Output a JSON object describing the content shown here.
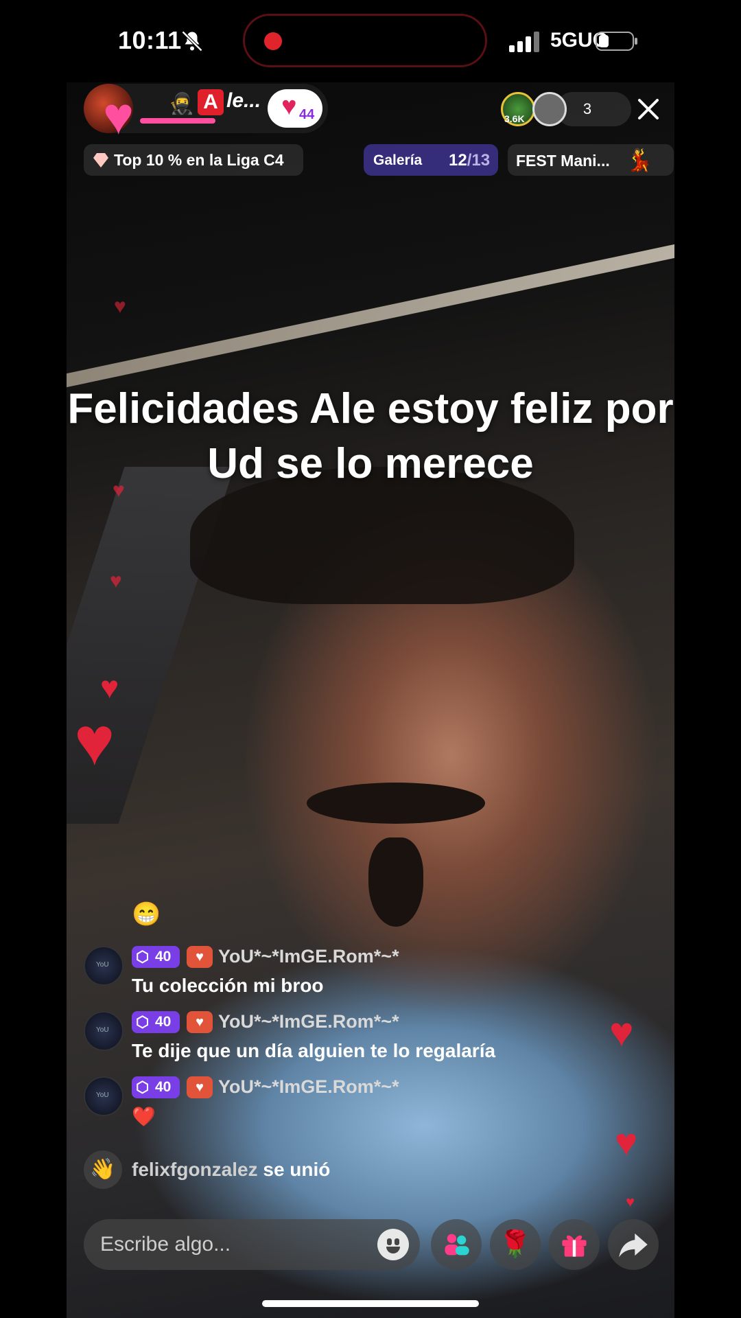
{
  "status_bar": {
    "time": "10:11",
    "network": "5GUC"
  },
  "host": {
    "name": "le...",
    "likes_count": "44"
  },
  "viewers": {
    "top_badge": "3.6K",
    "count": "3"
  },
  "league": {
    "label": "Top 10 % en la Liga C4"
  },
  "gallery": {
    "label": "Galería",
    "current": "12",
    "total": "/13"
  },
  "fest": {
    "label": "FEST Mani..."
  },
  "caption": "Felicidades Ale estoy feliz por Ud se lo merece",
  "chat": {
    "emoji_line": "😁",
    "comments": [
      {
        "level": "40",
        "user": "YoU*~*ImGE.Rom*~*",
        "message": "Tu colección mi broo"
      },
      {
        "level": "40",
        "user": "YoU*~*ImGE.Rom*~*",
        "message": "Te dije que un día alguien te lo regalaría"
      },
      {
        "level": "40",
        "user": "YoU*~*ImGE.Rom*~*",
        "message": "❤️"
      }
    ],
    "avatar_label": "YoU",
    "join": {
      "user": "felixfgonzalez",
      "text": " se unió"
    }
  },
  "composer": {
    "placeholder": "Escribe algo..."
  },
  "icons": {
    "mute": "bell-slash-icon",
    "close": "close-icon",
    "gift": "gift-icon",
    "share": "share-arrow-icon",
    "rose": "rose-icon",
    "guests": "multi-guest-icon",
    "wave": "wave-hand-icon"
  },
  "colors": {
    "heart": "#e2243a",
    "gallery_bg": "#3c328c",
    "level_badge": "#7a3ee6"
  }
}
